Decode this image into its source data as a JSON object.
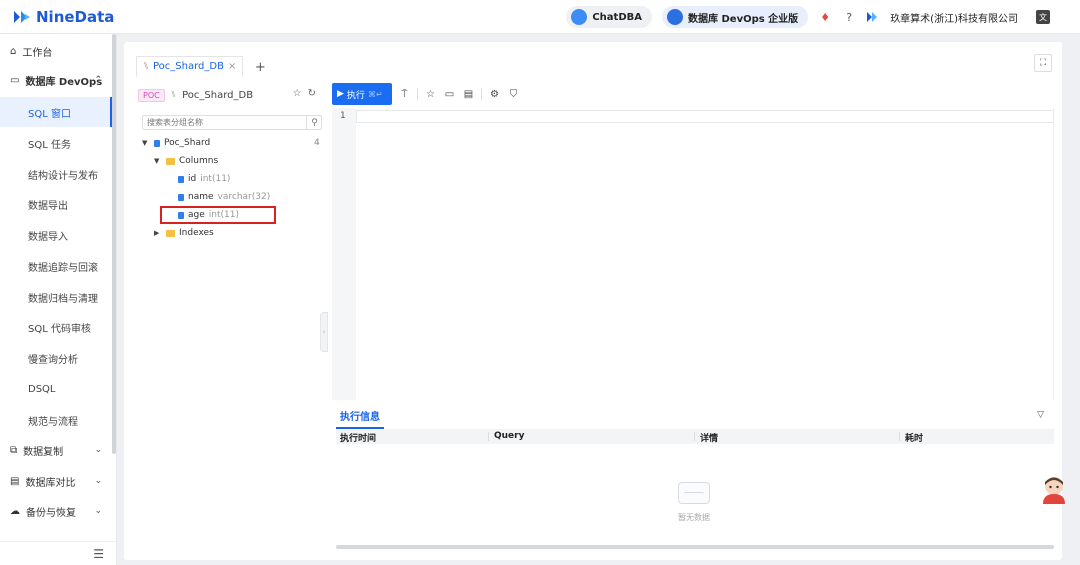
{
  "header": {
    "logo_text": "NineData",
    "chatdba_label": "ChatDBA",
    "edition_label": "数据库 DevOps 企业版",
    "org_name": "玖章算术(浙江)科技有限公司"
  },
  "sidebar": {
    "items": [
      {
        "label": "工作台",
        "icon": "home-icon"
      },
      {
        "label": "数据库 DevOps",
        "icon": "monitor-icon",
        "expanded": true
      },
      {
        "label": "SQL 窗口",
        "active": true
      },
      {
        "label": "SQL 任务"
      },
      {
        "label": "结构设计与发布"
      },
      {
        "label": "数据导出"
      },
      {
        "label": "数据导入"
      },
      {
        "label": "数据追踪与回滚"
      },
      {
        "label": "数据归档与清理"
      },
      {
        "label": "SQL 代码审核"
      },
      {
        "label": "慢查询分析"
      },
      {
        "label": "DSQL"
      },
      {
        "label": "规范与流程"
      },
      {
        "label": "数据复制",
        "icon": "replicate-icon"
      },
      {
        "label": "数据库对比",
        "icon": "compare-icon"
      },
      {
        "label": "备份与恢复",
        "icon": "backup-icon"
      }
    ]
  },
  "tabs": [
    {
      "label": "Poc_Shard_DB",
      "active": true
    }
  ],
  "tree": {
    "env_badge": "POC",
    "db_name": "Poc_Shard_DB",
    "search_placeholder": "搜索表分组名称",
    "table_name": "Poc_Shard",
    "table_count": "4",
    "columns_folder": "Columns",
    "columns": [
      {
        "name": "id",
        "type": "int(11)"
      },
      {
        "name": "name",
        "type": "varchar(32)"
      },
      {
        "name": "age",
        "type": "int(11)",
        "highlighted": true
      }
    ],
    "indexes_folder": "Indexes"
  },
  "editor": {
    "run_label": "执行",
    "run_shortcut": "⌘↵",
    "line_numbers": [
      "1"
    ]
  },
  "results": {
    "tab_label": "执行信息",
    "columns": [
      "执行时间",
      "Query",
      "详情",
      "耗时"
    ],
    "empty_text": "暂无数据"
  },
  "colors": {
    "accent": "#1a63e8",
    "highlight_border": "#d92121"
  }
}
